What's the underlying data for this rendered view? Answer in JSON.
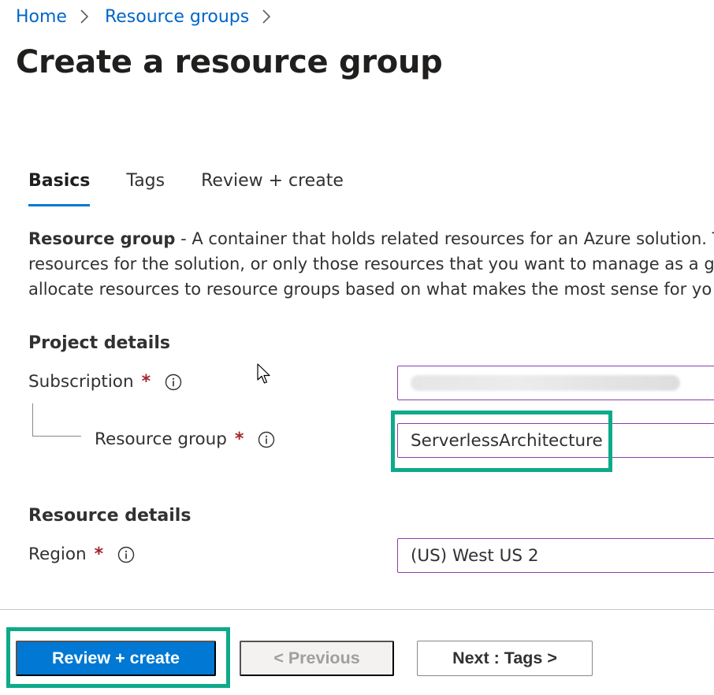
{
  "breadcrumb": {
    "items": [
      "Home",
      "Resource groups"
    ]
  },
  "page_title": "Create a resource group",
  "tabs": [
    {
      "label": "Basics",
      "active": true
    },
    {
      "label": "Tags",
      "active": false
    },
    {
      "label": "Review + create",
      "active": false
    }
  ],
  "description": {
    "bold": "Resource group",
    "line1": " - A container that holds related resources for an Azure solution. T",
    "line2": "resources for the solution, or only those resources that you want to manage as a g",
    "line3": "allocate resources to resource groups based on what makes the most sense for yo"
  },
  "project_details": {
    "title": "Project details",
    "subscription_label": "Subscription",
    "subscription_value": "",
    "resource_group_label": "Resource group",
    "resource_group_value": "ServerlessArchitecture"
  },
  "resource_details": {
    "title": "Resource details",
    "region_label": "Region",
    "region_value": "(US) West US 2"
  },
  "required_marker": "*",
  "footer": {
    "review_create": "Review + create",
    "previous": "< Previous",
    "next": "Next : Tags >"
  },
  "colors": {
    "link": "#0066c8",
    "primary": "#0078d4",
    "highlight": "#0eaa8a",
    "required": "#a4262c",
    "input_border": "#8a3fa8"
  },
  "icons": [
    "chevron-right-icon",
    "info-icon",
    "mouse-cursor-icon"
  ]
}
